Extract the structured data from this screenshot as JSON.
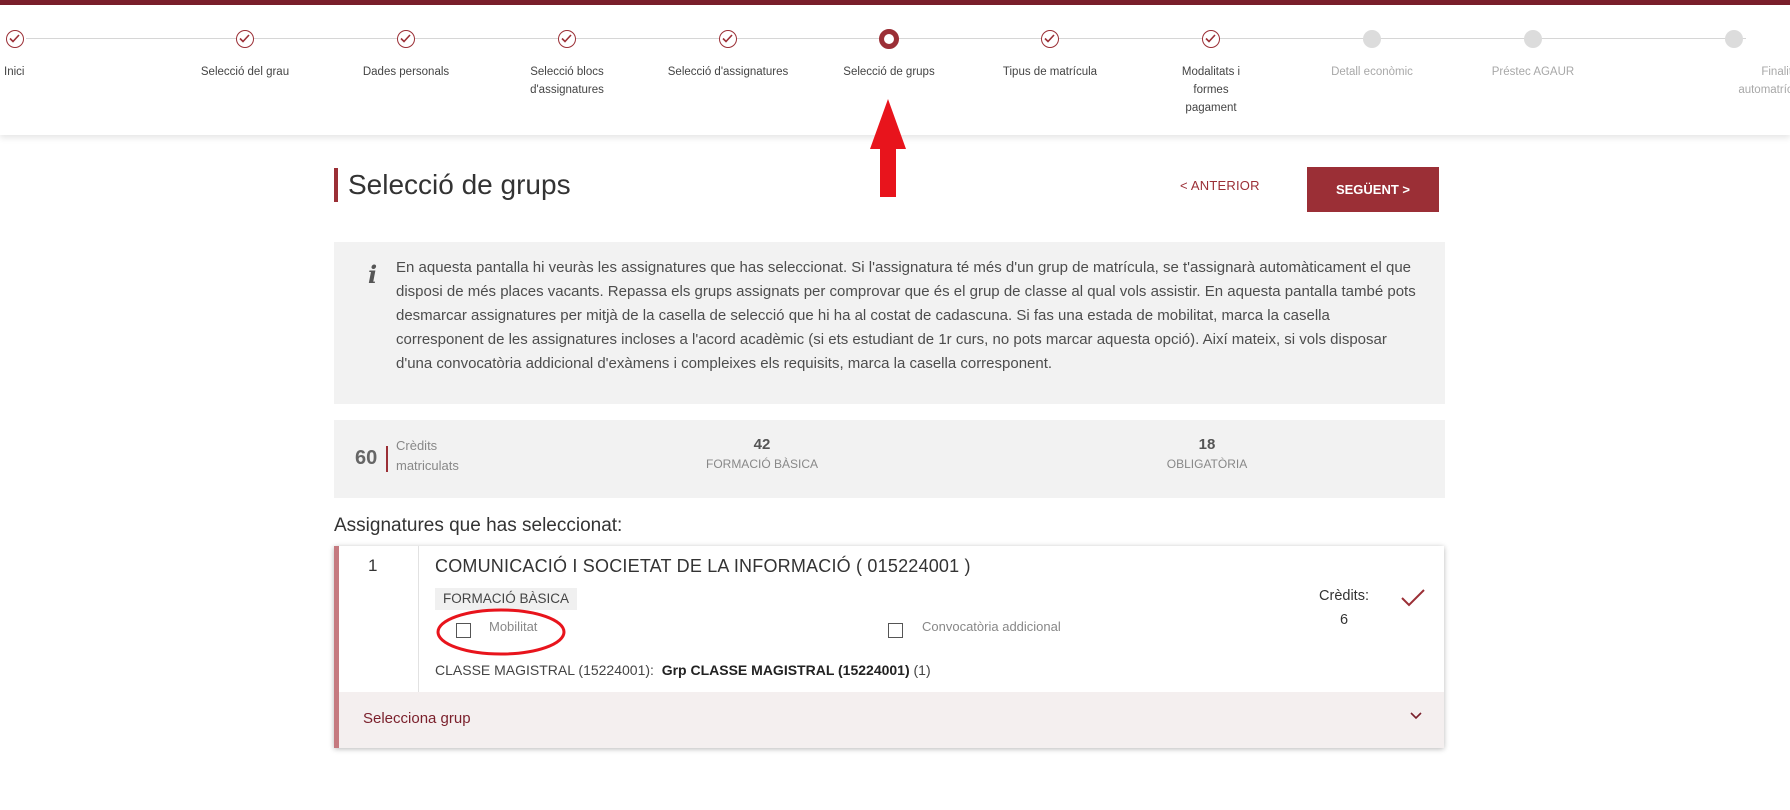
{
  "stepper": {
    "steps": [
      {
        "label": "Inici",
        "state": "done"
      },
      {
        "label": "Selecció del grau",
        "state": "done"
      },
      {
        "label": "Dades personals",
        "state": "done"
      },
      {
        "label": "Selecció blocs d'assignatures",
        "state": "done"
      },
      {
        "label": "Selecció d'assignatures",
        "state": "done"
      },
      {
        "label": "Selecció de grups",
        "state": "current"
      },
      {
        "label": "Tipus de matrícula",
        "state": "done"
      },
      {
        "label": "Modalitats i formes pagament",
        "state": "done"
      },
      {
        "label": "Detall econòmic",
        "state": "pending"
      },
      {
        "label": "Préstec AGAUR",
        "state": "pending"
      },
      {
        "label": "Finalitzar automatrícula",
        "state": "pending"
      }
    ]
  },
  "header": {
    "title": "Selecció de grups",
    "prev_label": "< ANTERIOR",
    "next_label": "SEGÜENT >"
  },
  "info": {
    "icon": "info-icon",
    "text": "En aquesta pantalla hi veuràs les assignatures que has seleccionat. Si l'assignatura té més d'un grup de matrícula, se t'assignarà automàticament el que disposi de més places vacants. Repassa els grups assignats per comprovar que és el grup de classe al qual vols assistir. En aquesta pantalla també pots desmarcar assignatures per mitjà de la casella de selecció que hi ha al costat de cadascuna. Si fas una estada de mobilitat, marca la casella corresponent de les assignatures incloses a l'acord acadèmic (si ets estudiant de 1r curs, no pots marcar aquesta opció). Així mateix, si vols disposar d'una convocatòria addicional d'exàmens i compleixes els requisits, marca la casella corresponent."
  },
  "summary": {
    "total": "60",
    "total_label": "Crèdits matriculats",
    "basic_value": "42",
    "basic_label": "FORMACIÓ BÀSICA",
    "mandatory_value": "18",
    "mandatory_label": "OBLIGATÒRIA"
  },
  "subjects": {
    "title": "Assignatures que has seleccionat:",
    "items": [
      {
        "number": "1",
        "name": "COMUNICACIÓ I SOCIETAT DE LA INFORMACIÓ ( 015224001 )",
        "type": "FORMACIÓ BÀSICA",
        "mobility_label": "Mobilitat",
        "mobility_checked": false,
        "extra_call_label": "Convocatòria addicional",
        "extra_call_checked": false,
        "credits_label": "Crèdits:",
        "credits": "6",
        "group_type": "CLASSE MAGISTRAL (15224001):",
        "group_name": "Grp CLASSE MAGISTRAL (15224001)",
        "group_count": "(1)",
        "select_group_label": "Selecciona grup"
      }
    ]
  },
  "colors": {
    "brand": "#9b2f36",
    "annotation": "#e8141c"
  }
}
